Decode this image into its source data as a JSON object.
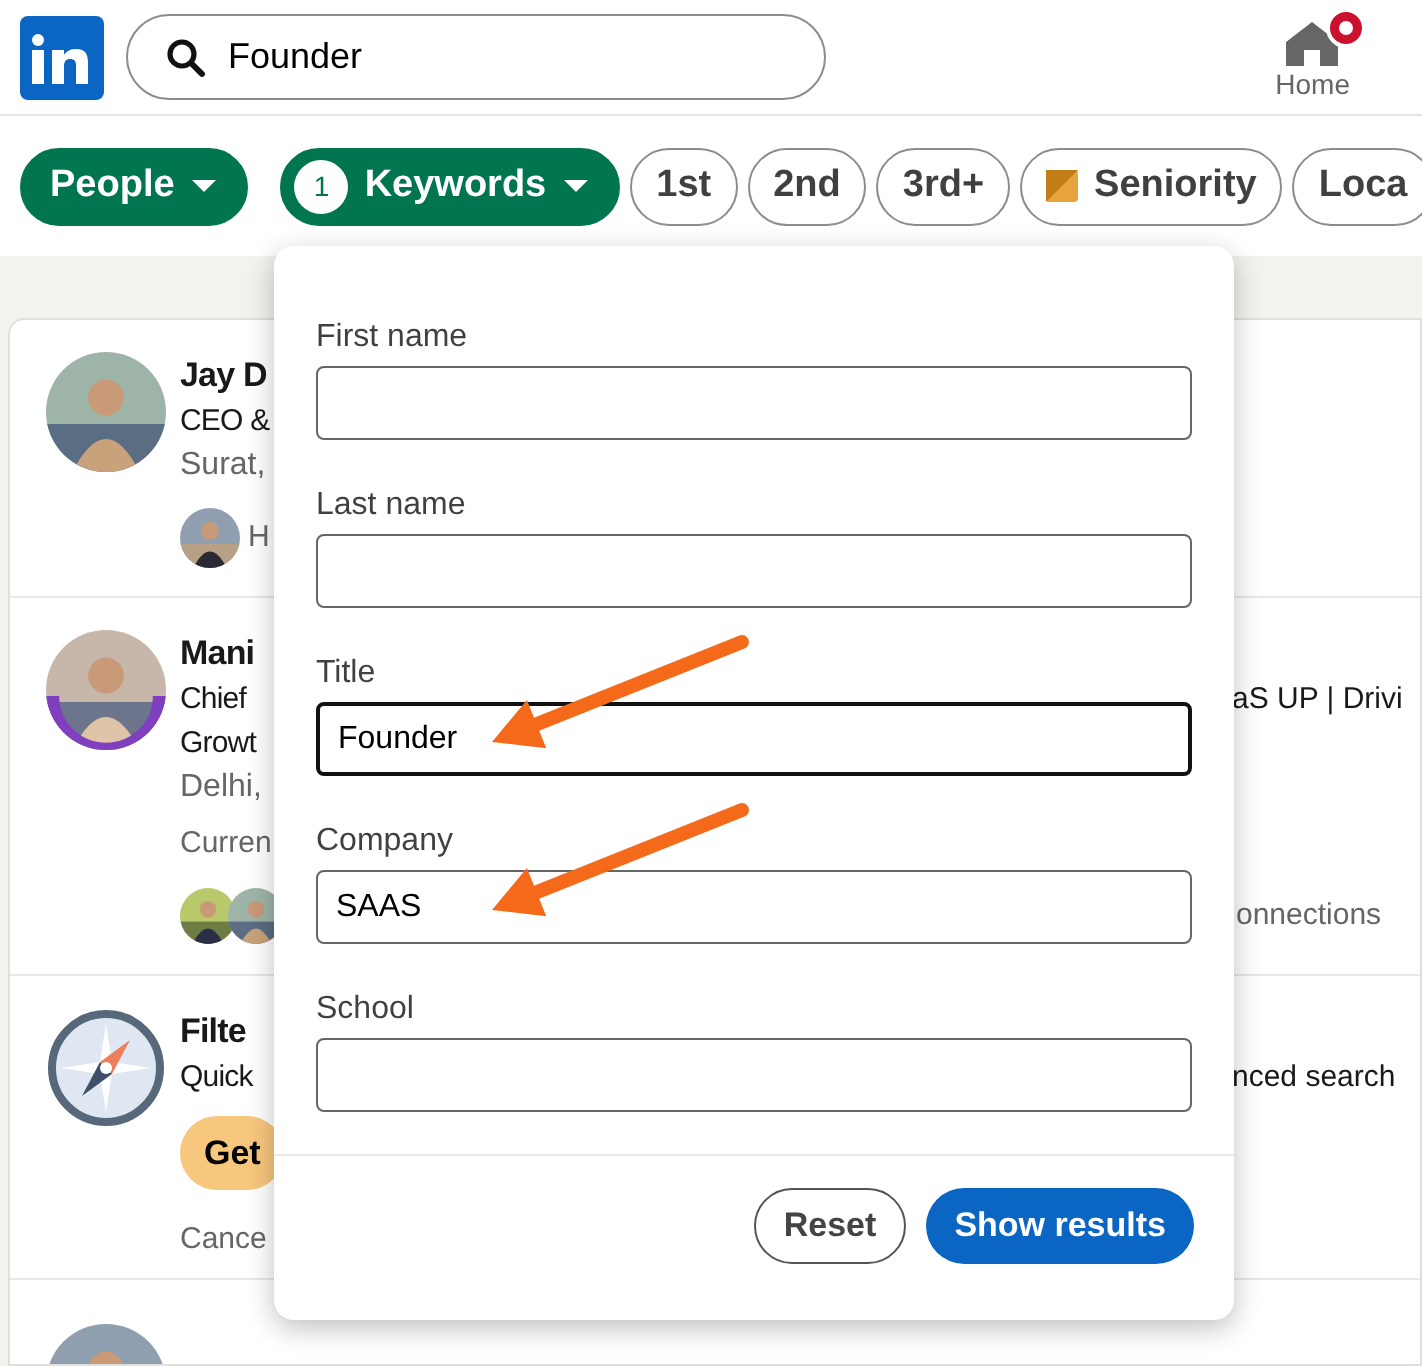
{
  "header": {
    "search_value": "Founder",
    "nav": [
      {
        "label": "Home",
        "notification": true
      }
    ]
  },
  "filters": [
    {
      "label": "People",
      "kind": "dropdown",
      "selected": true
    },
    {
      "label": "Keywords",
      "kind": "dropdown",
      "selected": true,
      "count": "1"
    },
    {
      "label": "1st",
      "kind": "plain",
      "selected": false
    },
    {
      "label": "2nd",
      "kind": "plain",
      "selected": false
    },
    {
      "label": "3rd+",
      "kind": "plain",
      "selected": false
    },
    {
      "label": "Seniority",
      "kind": "premium",
      "selected": false
    },
    {
      "label": "Loca",
      "kind": "plain",
      "selected": false
    }
  ],
  "results": [
    {
      "kind": "person",
      "hiring": false,
      "lines": [
        {
          "kind": "name",
          "text": "Jay D"
        },
        {
          "kind": "headline",
          "text": "CEO &"
        },
        {
          "kind": "location",
          "text": "Surat,"
        },
        {
          "kind": "connections",
          "text": "H"
        }
      ]
    },
    {
      "kind": "person",
      "hiring": true,
      "lines": [
        {
          "kind": "name",
          "text": "Mani"
        },
        {
          "kind": "headline",
          "text": "Chief",
          "right": "aS UP | Drivi"
        },
        {
          "kind": "headline",
          "text": "Growt"
        },
        {
          "kind": "location",
          "text": "Delhi,"
        },
        {
          "kind": "snippet",
          "text": "Curren"
        },
        {
          "kind": "connections",
          "right": "onnections"
        }
      ]
    },
    {
      "kind": "promo",
      "lines": [
        {
          "kind": "name",
          "text": "Filte"
        },
        {
          "kind": "headline",
          "text": "Quick",
          "right": "nced search"
        },
        {
          "kind": "button",
          "text": "Get"
        },
        {
          "kind": "snippet",
          "text": "Cance"
        }
      ]
    },
    {
      "kind": "person"
    }
  ],
  "keyword_panel": {
    "fields": [
      {
        "label": "First name",
        "focused": false
      },
      {
        "label": "Last name",
        "focused": false
      },
      {
        "label": "Title",
        "value": "Founder",
        "focused": true
      },
      {
        "label": "Company",
        "value": "SAAS",
        "focused": false
      },
      {
        "label": "School",
        "focused": false
      }
    ],
    "buttons": [
      {
        "label": "Reset",
        "kind": "secondary"
      },
      {
        "label": "Show results",
        "kind": "primary"
      }
    ]
  },
  "annotations": [
    {
      "kind": "arrow"
    },
    {
      "kind": "arrow"
    }
  ]
}
